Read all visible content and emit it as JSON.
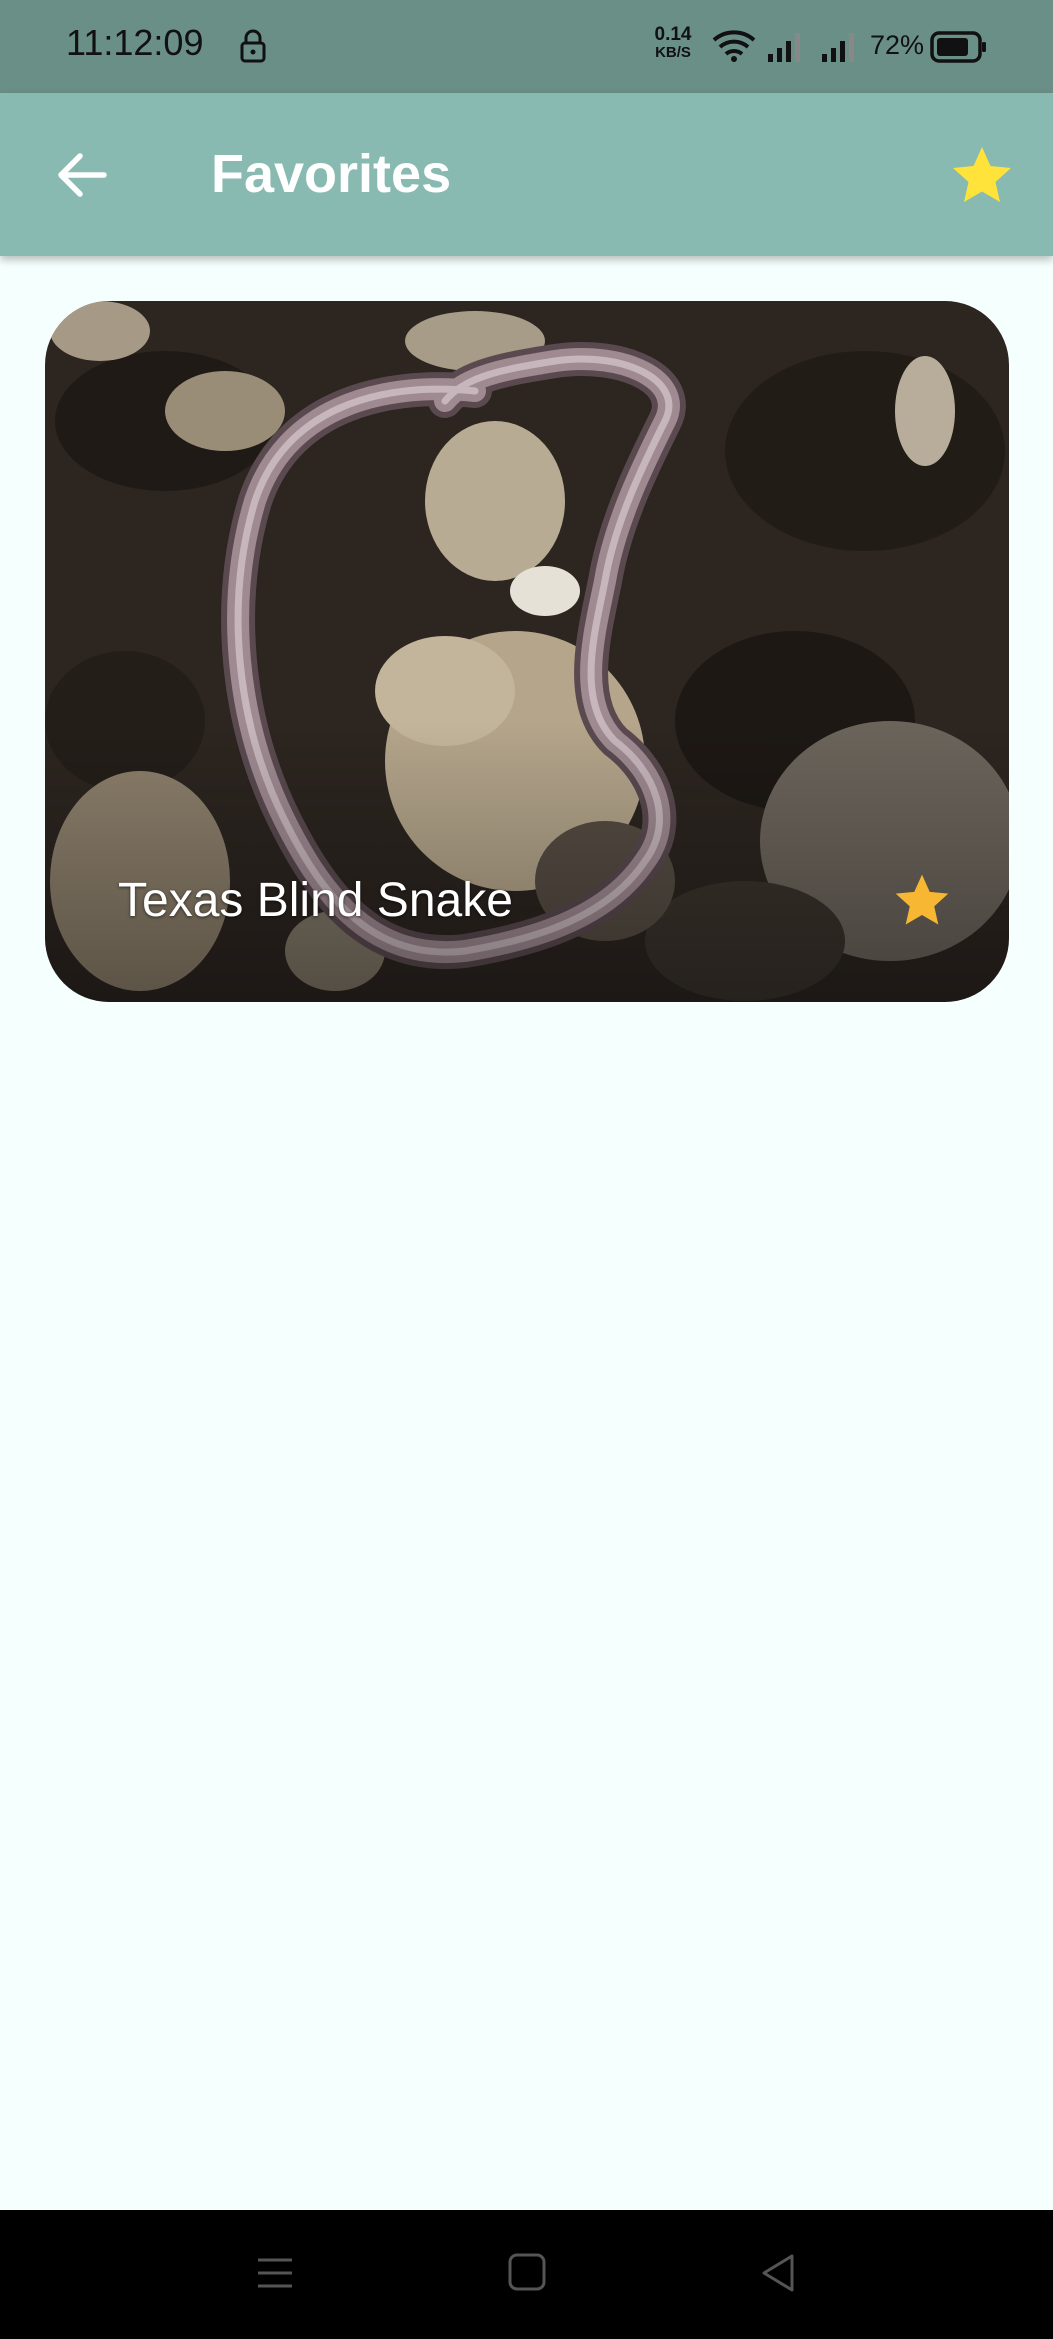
{
  "status_bar": {
    "time": "11:12:09",
    "net_speed_value": "0.14",
    "net_speed_unit": "KB/S",
    "battery": "72%"
  },
  "app_bar": {
    "title": "Favorites",
    "back_icon": "arrow-left-icon",
    "action_icon": "star-icon",
    "background": "#88bab1",
    "star_color": "#ffe23a"
  },
  "favorites": [
    {
      "name": "Texas Blind Snake",
      "favorite": true,
      "star_color": "#f7b733"
    }
  ],
  "nav_bar": {
    "buttons": [
      "menu-icon",
      "home-icon",
      "back-triangle-icon"
    ]
  }
}
